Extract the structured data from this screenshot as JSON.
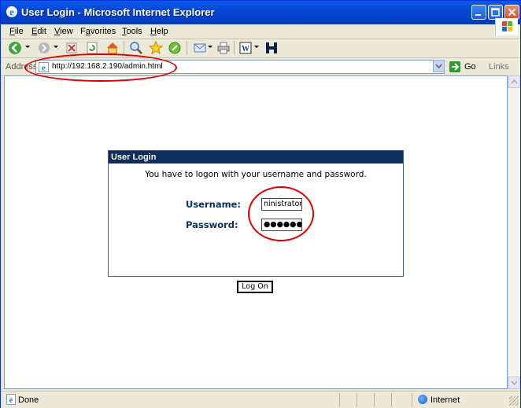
{
  "window": {
    "title": "User Login - Microsoft Internet Explorer"
  },
  "menubar": {
    "items": [
      {
        "hotkey": "F",
        "rest": "ile"
      },
      {
        "hotkey": "E",
        "rest": "dit"
      },
      {
        "hotkey": "V",
        "rest": "iew"
      },
      {
        "prefix": "F",
        "hotkey": "a",
        "rest": "vorites"
      },
      {
        "hotkey": "T",
        "rest": "ools"
      },
      {
        "hotkey": "H",
        "rest": "elp"
      }
    ]
  },
  "addressbar": {
    "label": "Address",
    "url": "http://192.168.2.190/admin.html",
    "go_label": "Go",
    "links_label": "Links"
  },
  "login": {
    "header": "User Login",
    "instruction": "You have to logon with your username and password.",
    "username_label": "Username:",
    "username_value": "ninistrator",
    "password_label": "Password:",
    "password_value": "●●●●●●",
    "logon_button": "Log On"
  },
  "statusbar": {
    "status": "Done",
    "zone": "Internet"
  },
  "colors": {
    "titlebar": "#0447d8",
    "login_header": "#0b2e5e",
    "label_color": "#0b2e5e",
    "annotation": "#e00000"
  }
}
